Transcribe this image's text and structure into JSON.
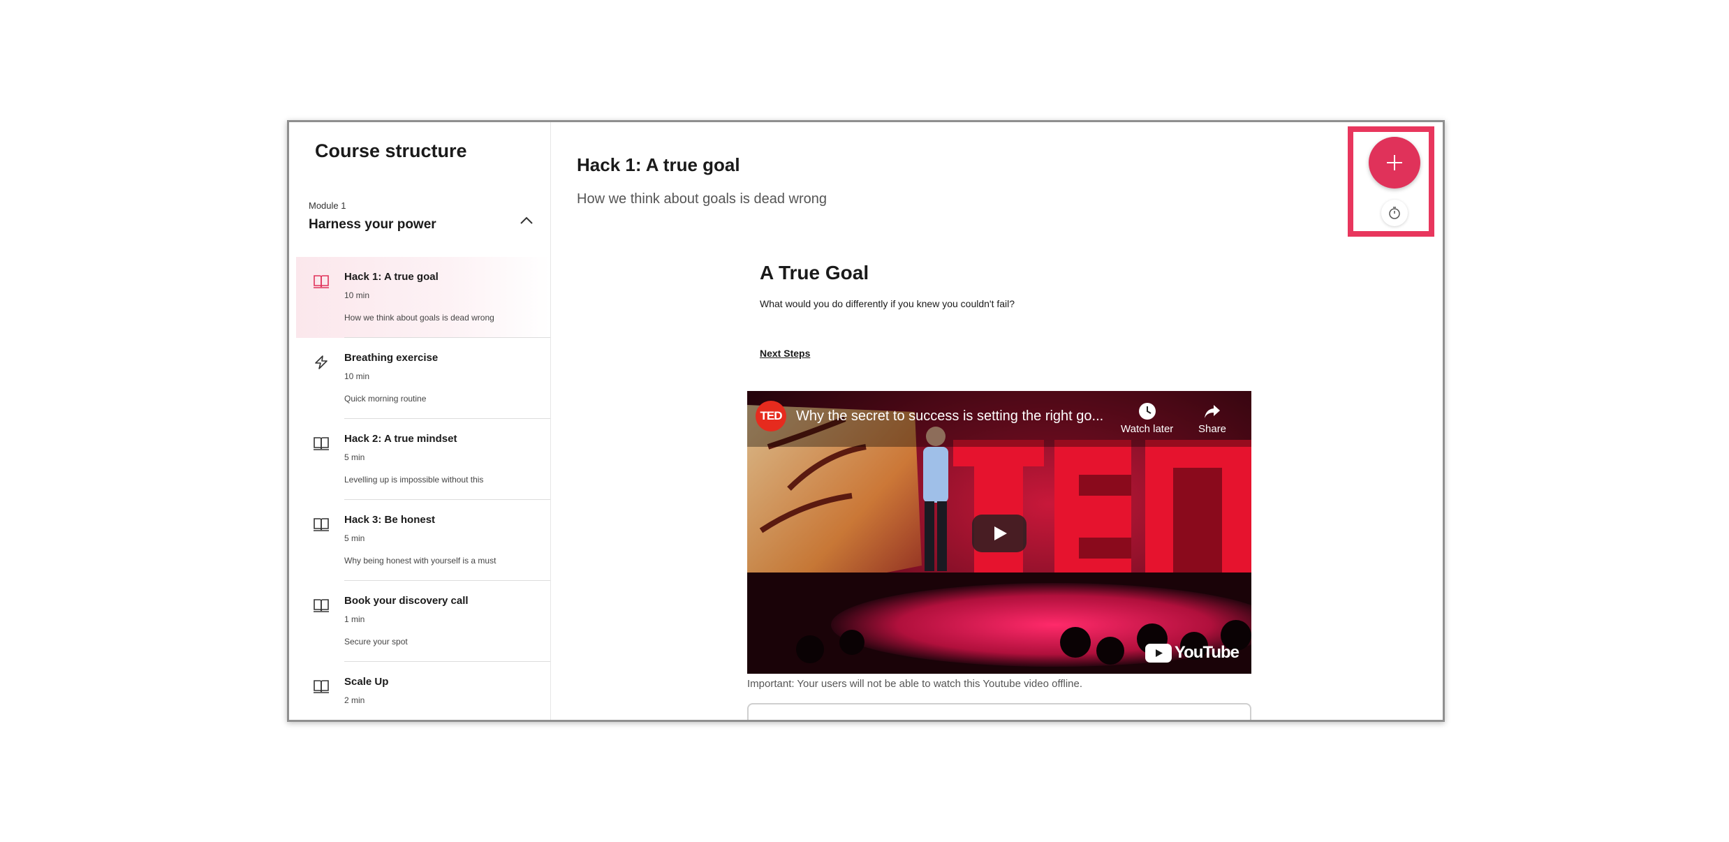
{
  "sidebar": {
    "title": "Course structure",
    "module": {
      "label": "Module 1",
      "name": "Harness your power"
    },
    "lessons": [
      {
        "title": "Hack 1: A true goal",
        "duration": "10 min",
        "description": "How we think about goals is dead wrong",
        "icon": "book-icon",
        "active": true
      },
      {
        "title": "Breathing exercise",
        "duration": "10 min",
        "description": "Quick morning routine",
        "icon": "lightning-icon",
        "active": false
      },
      {
        "title": "Hack 2: A true mindset",
        "duration": "5 min",
        "description": "Levelling up is impossible without this",
        "icon": "book-icon",
        "active": false
      },
      {
        "title": "Hack 3: Be honest",
        "duration": "5 min",
        "description": "Why being honest with yourself is a must",
        "icon": "book-icon",
        "active": false
      },
      {
        "title": "Book your discovery call",
        "duration": "1 min",
        "description": "Secure your spot",
        "icon": "book-icon",
        "active": false
      },
      {
        "title": "Scale Up",
        "duration": "2 min",
        "description": "",
        "icon": "book-icon",
        "active": false
      }
    ]
  },
  "main": {
    "title": "Hack 1: A true goal",
    "subtitle": "How we think about goals is dead wrong",
    "content": {
      "heading": "A True Goal",
      "question": "What would you do differently if you knew you couldn't fail?",
      "next_steps": "Next Steps"
    },
    "video": {
      "channel_logo": "TED",
      "title": "Why the secret to success is setting the right go...",
      "watch_later": "Watch later",
      "share": "Share",
      "brand": "YouTube"
    },
    "video_note": "Important: Your users will not be able to watch this Youtube video offline."
  },
  "actions": {
    "fab_icon": "plus-icon",
    "timer_icon": "stopwatch-icon"
  },
  "colors": {
    "accent": "#e0325a",
    "highlight": "#e8365d",
    "active_row": "#fbe7ec"
  }
}
